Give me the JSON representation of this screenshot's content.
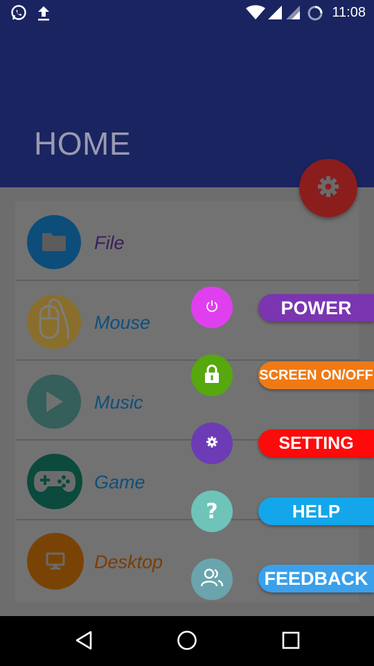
{
  "status_bar": {
    "time": "11:08",
    "left_icons": [
      "whatsapp-icon",
      "upload-icon"
    ],
    "right_icons": [
      "wifi-icon",
      "signal-icon",
      "signal-icon",
      "sync-icon"
    ]
  },
  "header": {
    "title": "HOME",
    "background": "#1a2460"
  },
  "fab": {
    "icon": "gear-icon",
    "color": "#8c1d1d"
  },
  "menu": {
    "items": [
      {
        "label": "File",
        "icon": "folder-icon",
        "circle_color": "#0d4d7a",
        "label_color": "#3b1e5e"
      },
      {
        "label": "Mouse",
        "icon": "mouse-icon",
        "circle_color": "#8a6e2c",
        "label_color": "#0f4f7a"
      },
      {
        "label": "Music",
        "icon": "play-icon",
        "circle_color": "#345f5a",
        "label_color": "#0f4f7a"
      },
      {
        "label": "Game",
        "icon": "gamepad-icon",
        "circle_color": "#0b4a3c",
        "label_color": "#0f4f7a"
      },
      {
        "label": "Desktop",
        "icon": "monitor-icon",
        "circle_color": "#7a4306",
        "label_color": "#7a3d06"
      }
    ]
  },
  "actions": [
    {
      "label": "POWER",
      "icon": "power-icon",
      "circle_color": "#e03ff0",
      "pill_color": "#7b35b0"
    },
    {
      "label": "SCREEN ON/OFF",
      "icon": "lock-icon",
      "circle_color": "#56a80e",
      "pill_color": "#ef7a15"
    },
    {
      "label": "SETTING",
      "icon": "gear-icon",
      "circle_color": "#6c3bb5",
      "pill_color": "#ff0a0a"
    },
    {
      "label": "HELP",
      "icon": "question-icon",
      "circle_color": "#6ec4b8",
      "pill_color": "#13a6ea"
    },
    {
      "label": "FEEDBACK",
      "icon": "people-icon",
      "circle_color": "#6aa4ad",
      "pill_color": "#3aa0ec"
    }
  ],
  "nav_bar": {
    "buttons": [
      "back-icon",
      "home-icon",
      "recents-icon"
    ]
  }
}
